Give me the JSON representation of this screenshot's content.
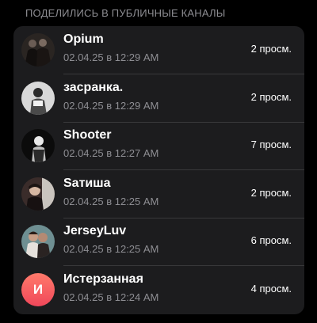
{
  "header": {
    "title": "ПОДЕЛИЛИСЬ В ПУБЛИЧНЫЕ КАНАЛЫ"
  },
  "channels": [
    {
      "name": "Opium",
      "datetime": "02.04.25 в 12:29 AM",
      "views": "2 просм.",
      "avatar": "photo"
    },
    {
      "name": "засранка.",
      "datetime": "02.04.25 в 12:29 AM",
      "views": "2 просм.",
      "avatar": "photo"
    },
    {
      "name": "Shooter",
      "datetime": "02.04.25 в 12:27 AM",
      "views": "7 просм.",
      "avatar": "photo"
    },
    {
      "name": "Sатиша",
      "datetime": "02.04.25 в 12:25 AM",
      "views": "2 просм.",
      "avatar": "photo"
    },
    {
      "name": "JerseyLuv",
      "datetime": "02.04.25 в 12:25 AM",
      "views": "6 просм.",
      "avatar": "photo"
    },
    {
      "name": "Истерзанная",
      "datetime": "02.04.25 в 12:24 AM",
      "views": "4 просм.",
      "avatar": "И",
      "avatar_color": "#f4566a"
    }
  ]
}
